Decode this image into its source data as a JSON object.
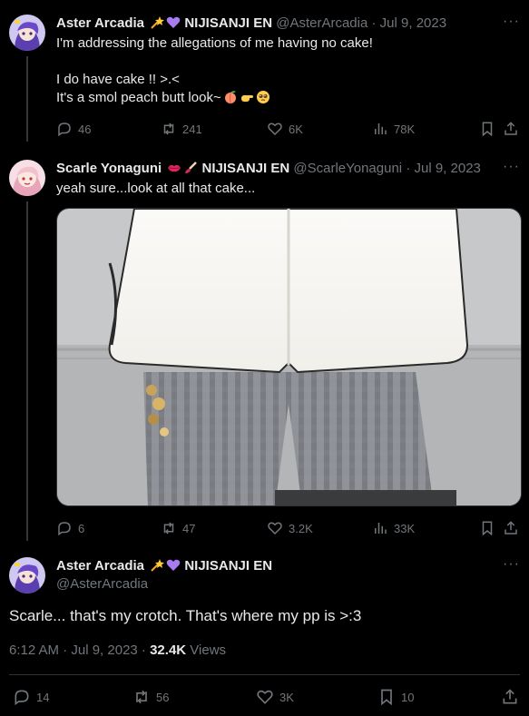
{
  "tweets": [
    {
      "name": "Aster Arcadia",
      "tag": "NIJISANJI EN",
      "handle": "@AsterArcadia",
      "sep": "·",
      "date": "Jul 9, 2023",
      "text_lines": [
        "I'm addressing the allegations of me having no cake!",
        "",
        "I do have cake !! >.<",
        "It's a smol peach butt look~"
      ],
      "stats": {
        "replies": "46",
        "reposts": "241",
        "likes": "6K",
        "views": "78K"
      }
    },
    {
      "name": "Scarle Yonaguni",
      "tag": "NIJISANJI EN",
      "handle": "@ScarleYonaguni",
      "sep": "·",
      "date": "Jul 9, 2023",
      "text": "yeah sure...look at all that cake...",
      "stats": {
        "replies": "6",
        "reposts": "47",
        "likes": "3.2K",
        "views": "33K"
      }
    }
  ],
  "main": {
    "name": "Aster Arcadia",
    "tag": "NIJISANJI EN",
    "handle": "@AsterArcadia",
    "text": "Scarle... that's my crotch. That's where my pp is >:3",
    "time": "6:12 AM · Jul 9, 2023 · ",
    "views_count": "32.4K",
    "views_label": " Views",
    "stats": {
      "replies": "14",
      "reposts": "56",
      "likes": "3K",
      "bookmarks": "10"
    }
  },
  "icons": {
    "more": "more-dots-icon",
    "reply": "reply-icon",
    "repost": "repost-icon",
    "like": "heart-icon",
    "views": "views-icon",
    "bookmark": "bookmark-icon",
    "share": "share-icon"
  },
  "colors": {
    "background": "#000000",
    "text": "#e7e9ea",
    "muted": "#71767b",
    "border": "#2f3336"
  }
}
